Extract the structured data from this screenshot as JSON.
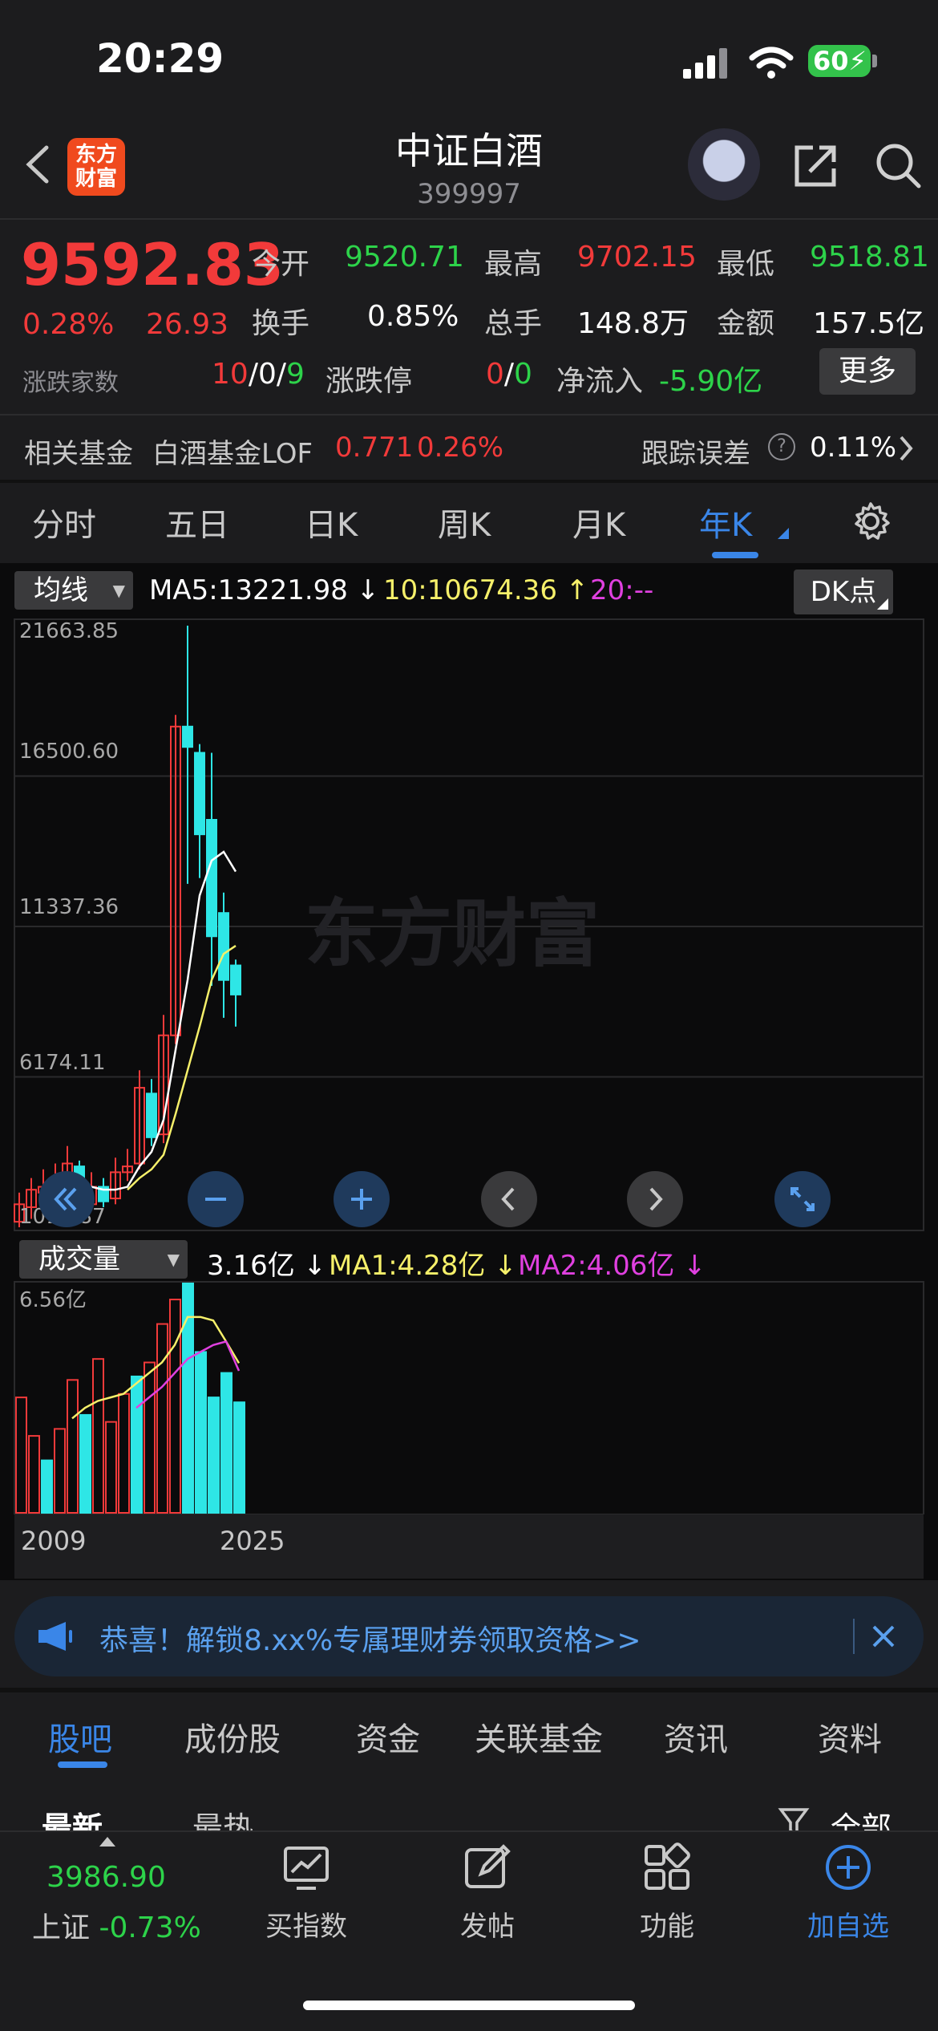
{
  "status_bar": {
    "time": "20:29",
    "battery": "60"
  },
  "header": {
    "logo_text_line1": "东方",
    "logo_text_line2": "财富",
    "title": "中证白酒",
    "code": "399997"
  },
  "quote": {
    "price": "9592.83",
    "change_pct": "0.28%",
    "change_amt": "26.93",
    "open_label": "今开",
    "open": "9520.71",
    "high_label": "最高",
    "high": "9702.15",
    "low_label": "最低",
    "low": "9518.81",
    "turnover_label": "换手",
    "turnover": "0.85%",
    "volume_label": "总手",
    "volume": "148.8万",
    "amount_label": "金额",
    "amount": "157.5亿",
    "breadth_label": "涨跌家数",
    "breadth_up": "10",
    "breadth_sep1": "/",
    "breadth_flat": "0",
    "breadth_sep2": "/",
    "breadth_down": "9",
    "limit_label": "涨跌停",
    "limit_up": "0",
    "limit_sep": "/",
    "limit_down": "0",
    "netflow_label": "净流入",
    "netflow": "-5.90亿",
    "more_label": "更多"
  },
  "fund_row": {
    "label": "相关基金",
    "fund_name": "白酒基金LOF",
    "fund_price": "0.771",
    "fund_change": "0.26%",
    "tracking_label": "跟踪误差",
    "tracking_value": "0.11%"
  },
  "k_tabs": [
    "分时",
    "五日",
    "日K",
    "周K",
    "月K",
    "年K"
  ],
  "k_tab_active": "年K",
  "chart_header": {
    "indicator": "均线",
    "ma5": "MA5:13221.98",
    "ma10": "10:10674.36",
    "ma20": "20:--",
    "dk_label": "DK点"
  },
  "volume_header": {
    "indicator": "成交量",
    "vol": "3.16亿",
    "ma1": "MA1:4.28亿",
    "ma2": "MA2:4.06亿"
  },
  "colors": {
    "up": "#f23a3a",
    "down": "#2ee6e6",
    "ma5": "#ffffff",
    "ma10": "#f6f06a",
    "ma20": "#e040e0",
    "accent": "#3a86e8"
  },
  "chart_data": {
    "type": "candlestick",
    "x_start_label": "2009",
    "x_end_label": "2025",
    "y_ticks": [
      "21663.85",
      "16500.60",
      "11337.36",
      "6174.11",
      "1010.87"
    ],
    "ylim": [
      1010.87,
      21663.85
    ],
    "candles": [
      {
        "o": 1200,
        "c": 1800,
        "h": 2200,
        "l": 1010.87,
        "up": true
      },
      {
        "o": 1700,
        "c": 2300,
        "h": 2700,
        "l": 1300,
        "up": true
      },
      {
        "o": 2200,
        "c": 2400,
        "h": 3000,
        "l": 1900,
        "up": true
      },
      {
        "o": 2300,
        "c": 2600,
        "h": 3200,
        "l": 2000,
        "up": true
      },
      {
        "o": 2700,
        "c": 3200,
        "h": 3800,
        "l": 2400,
        "up": true
      },
      {
        "o": 3100,
        "c": 1700,
        "h": 3300,
        "l": 1500,
        "up": false
      },
      {
        "o": 1800,
        "c": 2400,
        "h": 2900,
        "l": 1600,
        "up": true
      },
      {
        "o": 2400,
        "c": 1900,
        "h": 2700,
        "l": 1700,
        "up": false
      },
      {
        "o": 2000,
        "c": 2900,
        "h": 3400,
        "l": 1800,
        "up": true
      },
      {
        "o": 2900,
        "c": 3100,
        "h": 3700,
        "l": 2600,
        "up": true
      },
      {
        "o": 3200,
        "c": 5800,
        "h": 6400,
        "l": 3000,
        "up": true
      },
      {
        "o": 5600,
        "c": 4100,
        "h": 6100,
        "l": 3800,
        "up": false
      },
      {
        "o": 4200,
        "c": 7600,
        "h": 8300,
        "l": 3900,
        "up": true
      },
      {
        "o": 7600,
        "c": 18200,
        "h": 18600,
        "l": 7300,
        "up": true
      },
      {
        "o": 18200,
        "c": 17500,
        "h": 21663.85,
        "l": 12800,
        "up": false
      },
      {
        "o": 17300,
        "c": 14500,
        "h": 17600,
        "l": 13000,
        "up": false
      },
      {
        "o": 15000,
        "c": 11000,
        "h": 17300,
        "l": 9300,
        "up": false
      },
      {
        "o": 11800,
        "c": 9500,
        "h": 12500,
        "l": 8200,
        "up": false
      },
      {
        "o": 10000,
        "c": 9000,
        "h": 10200,
        "l": 7900,
        "up": false
      }
    ],
    "ma5": [
      null,
      null,
      null,
      null,
      2100,
      2300,
      2400,
      2300,
      2300,
      2400,
      3100,
      3600,
      4700,
      7100,
      9500,
      12400,
      13600,
      13900,
      13221.98
    ],
    "ma10": [
      null,
      null,
      null,
      null,
      null,
      null,
      null,
      null,
      null,
      2300,
      2700,
      3000,
      3500,
      4900,
      6400,
      7900,
      9500,
      10400,
      10674.36
    ],
    "volume": {
      "y_max_label": "6.56亿",
      "ymax": 6.56,
      "bars": [
        3.3,
        2.2,
        1.5,
        2.4,
        3.8,
        2.8,
        4.4,
        2.6,
        3.4,
        3.9,
        4.3,
        5.4,
        6.1,
        6.56,
        4.6,
        3.3,
        4.0,
        3.16
      ],
      "up_flags": [
        true,
        true,
        false,
        true,
        true,
        false,
        true,
        true,
        true,
        false,
        true,
        true,
        true,
        false,
        false,
        false,
        false,
        false
      ],
      "ma1": [
        null,
        null,
        null,
        null,
        2.7,
        3.0,
        3.2,
        3.3,
        3.4,
        3.7,
        4.0,
        4.3,
        4.8,
        5.6,
        5.6,
        5.5,
        4.9,
        4.28
      ],
      "ma2": [
        null,
        null,
        null,
        null,
        null,
        null,
        null,
        null,
        null,
        3.0,
        3.3,
        3.6,
        4.0,
        4.4,
        4.6,
        4.8,
        4.9,
        4.06
      ]
    }
  },
  "banner": {
    "text": "恭喜！解锁8.xx%专属理财券领取资格>>"
  },
  "bottom_tabs": [
    "股吧",
    "成份股",
    "资金",
    "关联基金",
    "资讯",
    "资料"
  ],
  "bottom_tab_active": "股吧",
  "sub_tabs": {
    "latest": "最新",
    "hot": "最热",
    "filter": "全部"
  },
  "bottom_nav": {
    "index_value": "3986.90",
    "index_name": "上证",
    "index_change": "-0.73%",
    "items": [
      "买指数",
      "发帖",
      "功能",
      "加自选"
    ]
  }
}
